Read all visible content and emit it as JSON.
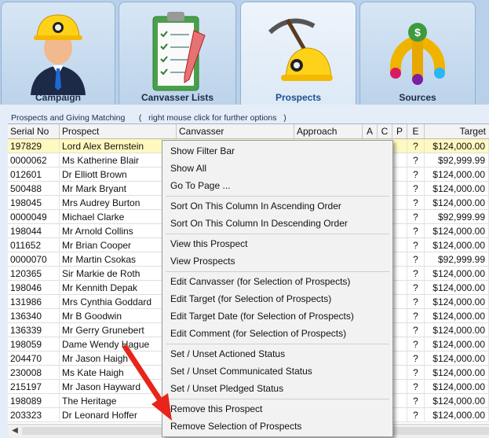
{
  "tabs": [
    {
      "label": "Campaign",
      "icon": "miner-person-icon",
      "active": false
    },
    {
      "label": "Canvasser Lists",
      "icon": "clipboard-checklist-icon",
      "active": false
    },
    {
      "label": "Prospects",
      "icon": "pickaxe-helmet-icon",
      "active": true
    },
    {
      "label": "Sources",
      "icon": "money-fountain-icon",
      "active": false
    }
  ],
  "caption": "Prospects and Giving Matching      (   right mouse click for further options   )",
  "columns": {
    "serial": "Serial No",
    "prospect": "Prospect",
    "canvasser": "Canvasser",
    "approach": "Approach",
    "a": "A",
    "c": "C",
    "p": "P",
    "e": "E",
    "target": "Target"
  },
  "rows": [
    {
      "serial": "197829",
      "prospect": "Lord Alex Bernstein",
      "e": "?",
      "target": "$124,000.00"
    },
    {
      "serial": "0000062",
      "prospect": "Ms Katherine Blair",
      "e": "?",
      "target": "$92,999.99"
    },
    {
      "serial": "012601",
      "prospect": "Dr Elliott Brown",
      "e": "?",
      "target": "$124,000.00"
    },
    {
      "serial": "500488",
      "prospect": "Mr Mark Bryant",
      "e": "?",
      "target": "$124,000.00"
    },
    {
      "serial": "198045",
      "prospect": "Mrs Audrey Burton",
      "e": "?",
      "target": "$124,000.00"
    },
    {
      "serial": "0000049",
      "prospect": " Michael Clarke",
      "e": "?",
      "target": "$92,999.99"
    },
    {
      "serial": "198044",
      "prospect": "Mr Arnold Collins",
      "e": "?",
      "target": "$124,000.00"
    },
    {
      "serial": "011652",
      "prospect": "Mr Brian Cooper",
      "e": "?",
      "target": "$124,000.00"
    },
    {
      "serial": "0000070",
      "prospect": "Mr Martin Csokas",
      "e": "?",
      "target": "$92,999.99"
    },
    {
      "serial": "120365",
      "prospect": "Sir Markie de Roth",
      "e": "?",
      "target": "$124,000.00"
    },
    {
      "serial": "198046",
      "prospect": "Mr Kennith Depak",
      "e": "?",
      "target": "$124,000.00"
    },
    {
      "serial": "131986",
      "prospect": "Mrs Cynthia Goddard",
      "e": "?",
      "target": "$124,000.00"
    },
    {
      "serial": "136340",
      "prospect": "Mr B Goodwin",
      "e": "?",
      "target": "$124,000.00"
    },
    {
      "serial": "136339",
      "prospect": "Mr Gerry Grunebert",
      "e": "?",
      "target": "$124,000.00"
    },
    {
      "serial": "198059",
      "prospect": "Dame Wendy Hague",
      "e": "?",
      "target": "$124,000.00"
    },
    {
      "serial": "204470",
      "prospect": "Mr Jason Haigh",
      "e": "?",
      "target": "$124,000.00"
    },
    {
      "serial": "230008",
      "prospect": "Ms Kate Haigh",
      "e": "?",
      "target": "$124,000.00"
    },
    {
      "serial": "215197",
      "prospect": "Mr Jason Hayward",
      "e": "?",
      "target": "$124,000.00"
    },
    {
      "serial": "198089",
      "prospect": "The  Heritage",
      "e": "?",
      "target": "$124,000.00"
    },
    {
      "serial": "203323",
      "prospect": "Dr Leonard Hoffer",
      "e": "?",
      "target": "$124,000.00"
    }
  ],
  "menu": {
    "show_filter_bar": "Show Filter Bar",
    "show_all": "Show All",
    "go_to_page": "Go To Page ...",
    "sort_asc": "Sort On This Column In Ascending Order",
    "sort_desc": "Sort On This Column In Descending Order",
    "view_this": "View this Prospect",
    "view_prospects": "View Prospects",
    "edit_canvasser": "Edit Canvasser (for Selection of Prospects)",
    "edit_target": "Edit Target (for Selection of Prospects)",
    "edit_target_date": "Edit Target Date (for Selection of Prospects)",
    "edit_comment": "Edit Comment (for Selection of Prospects)",
    "actioned": "Set / Unset Actioned Status",
    "communicated": "Set / Unset Communicated Status",
    "pledged": "Set / Unset Pledged Status",
    "remove_this": "Remove this Prospect",
    "remove_selection": "Remove Selection of Prospects"
  },
  "colors": {
    "accent": "#1c4f8f",
    "selected_row": "#fff9bf",
    "annotation_arrow": "#e8241b"
  }
}
